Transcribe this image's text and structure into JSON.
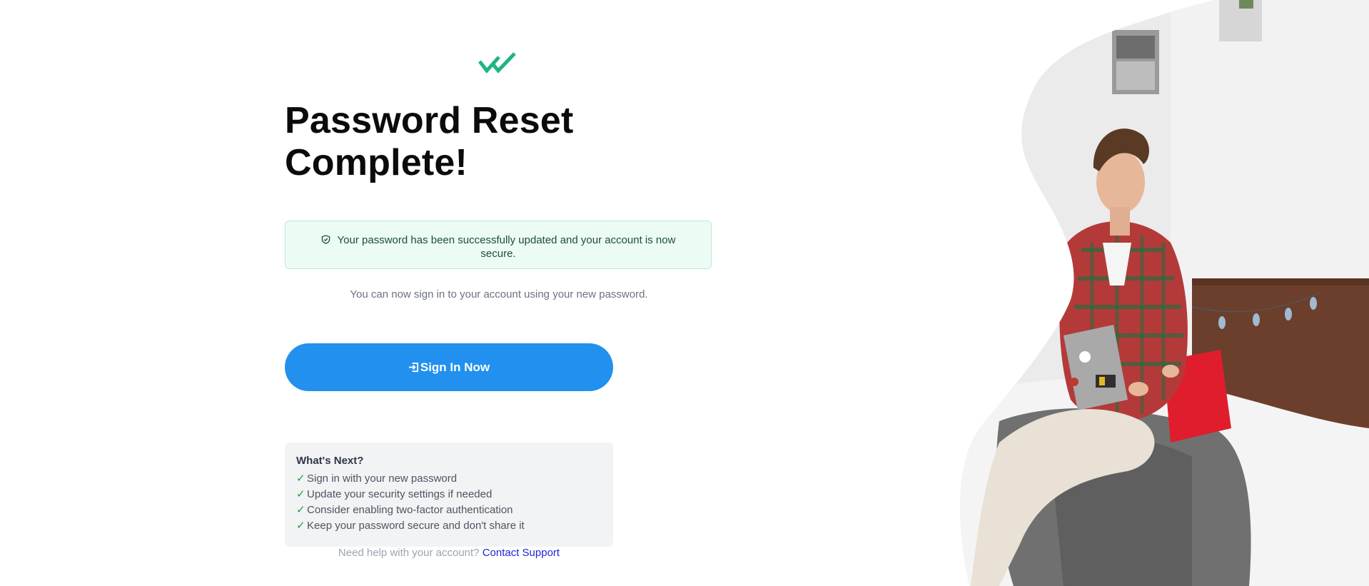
{
  "header": {
    "title_line1": "Password Reset",
    "title_line2": "Complete!",
    "logo_icon": "double-check-icon",
    "brand_color": "#1cb57f"
  },
  "alert": {
    "icon": "shield-check-icon",
    "message": "Your password has been successfully updated and your account is now secure."
  },
  "subtext": "You can now sign in to your account using your new password.",
  "signin_button": {
    "icon": "sign-in-icon",
    "label": "Sign In Now",
    "color": "#2190ee"
  },
  "whats_next": {
    "title": "What's Next?",
    "items": [
      "Sign in with your new password",
      "Update your security settings if needed",
      "Consider enabling two-factor authentication",
      "Keep your password secure and don't share it"
    ]
  },
  "help": {
    "prompt": "Need help with your account?",
    "link_label": "Contact Support"
  }
}
